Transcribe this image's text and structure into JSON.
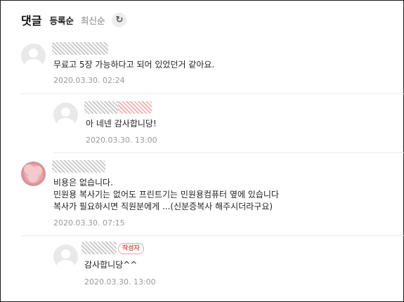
{
  "header": {
    "title": "댓글",
    "sort_register": "등록순",
    "sort_latest": "최신순",
    "refresh_icon": "refresh-icon"
  },
  "comments": [
    {
      "text": "무료고 5장 가능하다고 되어 있었던거 같아요.",
      "date": "2020.03.30. 02:24",
      "avatar": "default-avatar"
    },
    {
      "reply": true,
      "text": "아 네넨 감사합니당!",
      "date": "2020.03.30. 13:00",
      "avatar": "default-avatar"
    },
    {
      "text_lines": [
        "비용은 없습니다.",
        "민원용 복사기는 없어도 프린트기는 민원용컴퓨터 옆에 있습니다",
        "복사가 필요하시면 직원분에게 ...(신분증복사 해주시더라구요)"
      ],
      "date": "2020.03.30. 07:15",
      "avatar": "flower-avatar"
    },
    {
      "reply": true,
      "badge": "작성자",
      "text": "감사합니당^^",
      "date": "2020.03.30. 13:00",
      "avatar": "default-avatar"
    }
  ],
  "colors": {
    "date": "#999999",
    "badge": "#e24e4e",
    "divider": "#ececec"
  }
}
